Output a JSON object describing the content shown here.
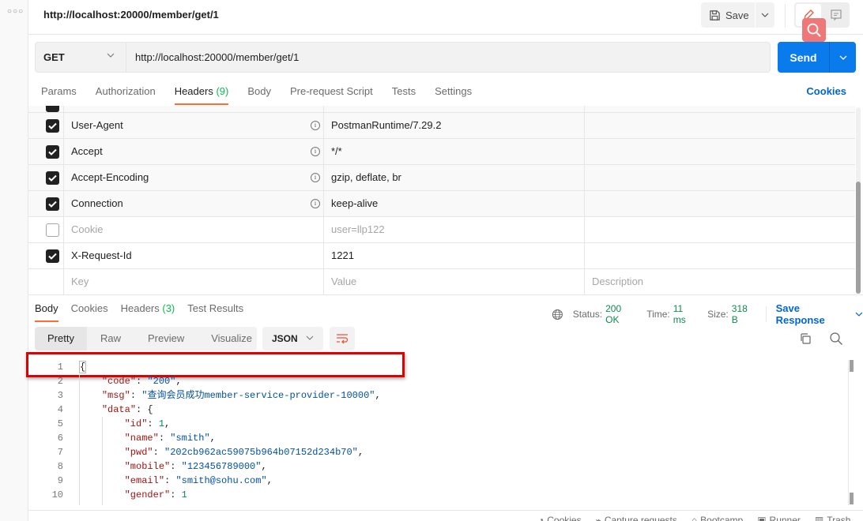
{
  "window": {
    "title": "http://localhost:20000/member/get/1",
    "save_label": "Save"
  },
  "request": {
    "method": "GET",
    "url": "http://localhost:20000/member/get/1",
    "send_label": "Send"
  },
  "request_tabs": [
    {
      "label": "Params"
    },
    {
      "label": "Authorization"
    },
    {
      "label": "Headers",
      "count": "(9)",
      "active": true
    },
    {
      "label": "Body"
    },
    {
      "label": "Pre-request Script"
    },
    {
      "label": "Tests"
    },
    {
      "label": "Settings"
    }
  ],
  "cookies_link": "Cookies",
  "headers": {
    "rows": [
      {
        "key": "User-Agent",
        "value": "PostmanRuntime/7.29.2",
        "checked": true,
        "info": true
      },
      {
        "key": "Accept",
        "value": "*/*",
        "checked": true,
        "info": true
      },
      {
        "key": "Accept-Encoding",
        "value": "gzip, deflate, br",
        "checked": true,
        "info": true
      },
      {
        "key": "Connection",
        "value": "keep-alive",
        "checked": true,
        "info": true
      },
      {
        "key": "Cookie",
        "value": "user=llp122",
        "checked": false,
        "info": false
      },
      {
        "key": "X-Request-Id",
        "value": "1221",
        "checked": true,
        "info": false
      }
    ],
    "placeholders": {
      "key": "Key",
      "value": "Value",
      "description": "Description"
    }
  },
  "response_tabs": [
    {
      "label": "Body",
      "active": true
    },
    {
      "label": "Cookies"
    },
    {
      "label": "Headers",
      "count": "(3)"
    },
    {
      "label": "Test Results"
    }
  ],
  "response_meta": {
    "status_label": "Status:",
    "status_value": "200 OK",
    "time_label": "Time:",
    "time_value": "11 ms",
    "size_label": "Size:",
    "size_value": "318 B",
    "save_response": "Save Response"
  },
  "view_modes": [
    "Pretty",
    "Raw",
    "Preview",
    "Visualize"
  ],
  "format": "JSON",
  "code_lines": [
    {
      "n": "1"
    },
    {
      "n": "2"
    },
    {
      "n": "3"
    },
    {
      "n": "4"
    },
    {
      "n": "5"
    },
    {
      "n": "6"
    },
    {
      "n": "7"
    },
    {
      "n": "8"
    },
    {
      "n": "9"
    },
    {
      "n": "10"
    }
  ],
  "response_body": {
    "code": "200",
    "msg": "查询会员成功member-service-provider-10000",
    "data": {
      "id": "1",
      "name": "smith",
      "pwd": "202cb962ac59075b964b07152d234b70",
      "mobile": "123456789000",
      "email": "smith@sohu.com",
      "gender": "1"
    }
  },
  "statusbar": [
    "Cookies",
    "Capture requests",
    "Bootcamp",
    "Runner",
    "Trash"
  ],
  "colors": {
    "accent_orange": "#ff6c37",
    "send_blue": "#097bed",
    "link_blue": "#0265d2",
    "status_green": "#0f8a50",
    "highlight_red": "#e00000"
  }
}
